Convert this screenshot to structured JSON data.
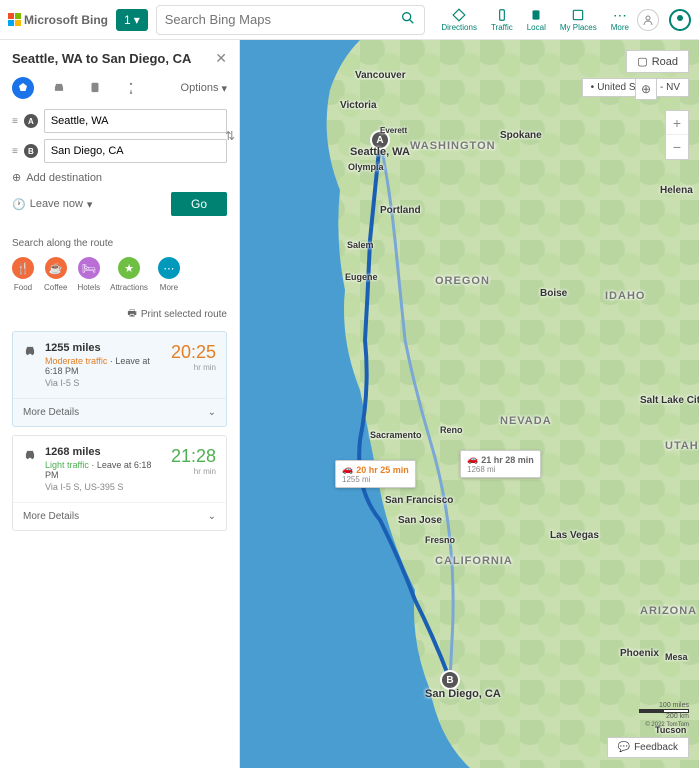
{
  "header": {
    "logo": "Microsoft Bing",
    "tab_label": "1",
    "search_placeholder": "Search Bing Maps",
    "nav": [
      {
        "label": "Directions"
      },
      {
        "label": "Traffic"
      },
      {
        "label": "Local"
      },
      {
        "label": "My Places"
      },
      {
        "label": "More"
      }
    ]
  },
  "panel": {
    "title": "Seattle, WA to San Diego, CA",
    "options_label": "Options",
    "waypoint_a": "Seattle, WA",
    "waypoint_b": "San Diego, CA",
    "add_dest": "Add destination",
    "leave_now": "Leave now",
    "go_label": "Go",
    "search_along": "Search along the route",
    "cats": [
      {
        "label": "Food",
        "color": "#f26b3a"
      },
      {
        "label": "Coffee",
        "color": "#f26b3a"
      },
      {
        "label": "Hotels",
        "color": "#b96fd6"
      },
      {
        "label": "Attractions",
        "color": "#6fbf44"
      },
      {
        "label": "More",
        "color": "#0099bc"
      }
    ],
    "print_label": "Print selected route",
    "routes": [
      {
        "distance": "1255 miles",
        "traffic": "Moderate traffic",
        "depart": "Leave at 6:18 PM",
        "via": "Via I-5 S",
        "time": "20:25",
        "unit": "hr  min",
        "more": "More Details"
      },
      {
        "distance": "1268 miles",
        "traffic": "Light traffic",
        "depart": "Leave at 6:18 PM",
        "via": "Via I-5 S, US-395 S",
        "time": "21:28",
        "unit": "hr  min",
        "more": "More Details"
      }
    ]
  },
  "map": {
    "layer_label": "Road",
    "region": "United States - NV",
    "tooltip1_time": "20 hr 25 min",
    "tooltip1_dist": "1255 mi",
    "tooltip2_time": "21 hr 28 min",
    "tooltip2_dist": "1268 mi",
    "pin_a_label": "Seattle, WA",
    "pin_b_label": "San Diego, CA",
    "labels": {
      "vancouver": "Vancouver",
      "victoria": "Victoria",
      "everett": "Everett",
      "spokane": "Spokane",
      "washington": "WASHINGTON",
      "olympia": "Olympia",
      "helena": "Helena",
      "portland": "Portland",
      "salem": "Salem",
      "oregon": "OREGON",
      "eugene": "Eugene",
      "boise": "Boise",
      "idaho": "IDAHO",
      "slc": "Salt Lake City",
      "sacramento": "Sacramento",
      "reno": "Reno",
      "nevada": "NEVADA",
      "utah": "UTAH",
      "sf": "San Francisco",
      "sj": "San Jose",
      "fresno": "Fresno",
      "california": "CALIFORNIA",
      "lv": "Las Vegas",
      "arizona": "ARIZONA",
      "phoenix": "Phoenix",
      "mesa": "Mesa",
      "tucson": "Tucson"
    },
    "feedback": "Feedback",
    "scale1": "100 miles",
    "scale2": "200 km",
    "copyright": "© 2022 TomTom"
  }
}
